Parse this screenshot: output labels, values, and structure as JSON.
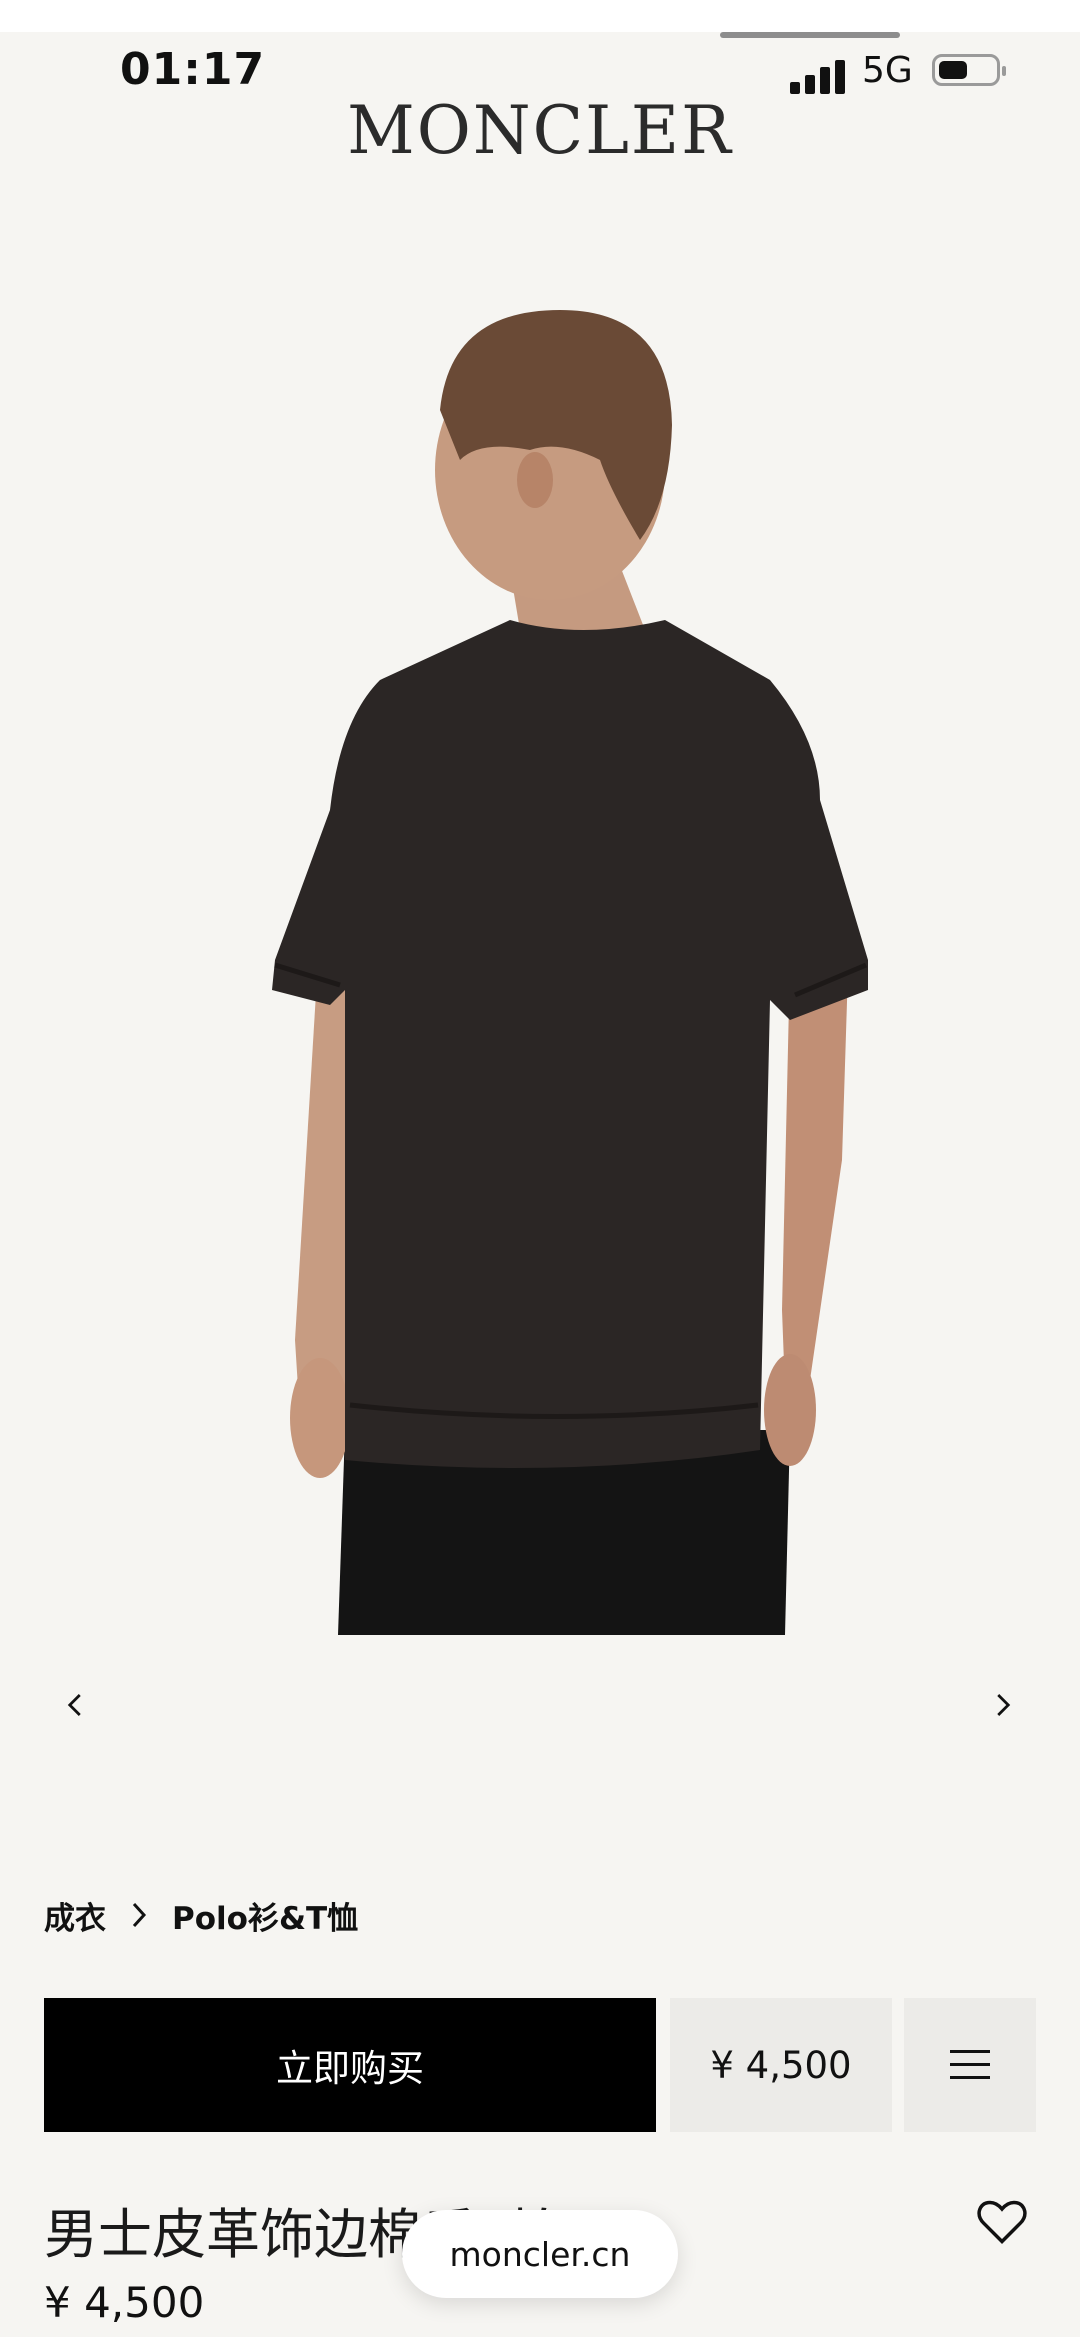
{
  "status_bar": {
    "time": "01:17",
    "network": "5G"
  },
  "header": {
    "brand": "MONCLER"
  },
  "breadcrumb": {
    "category": "成衣",
    "subcategory": "Polo衫&T恤"
  },
  "actions": {
    "buy_label": "立即购买",
    "price": "¥ 4,500"
  },
  "product": {
    "title": "男士皮革饰边棉质T恤",
    "price": "¥ 4,500"
  },
  "browser": {
    "url": "moncler.cn"
  },
  "colors": {
    "accent_button": "#000000",
    "page_bg": "#f6f5f2",
    "secondary_button_bg": "#ecebe8"
  }
}
